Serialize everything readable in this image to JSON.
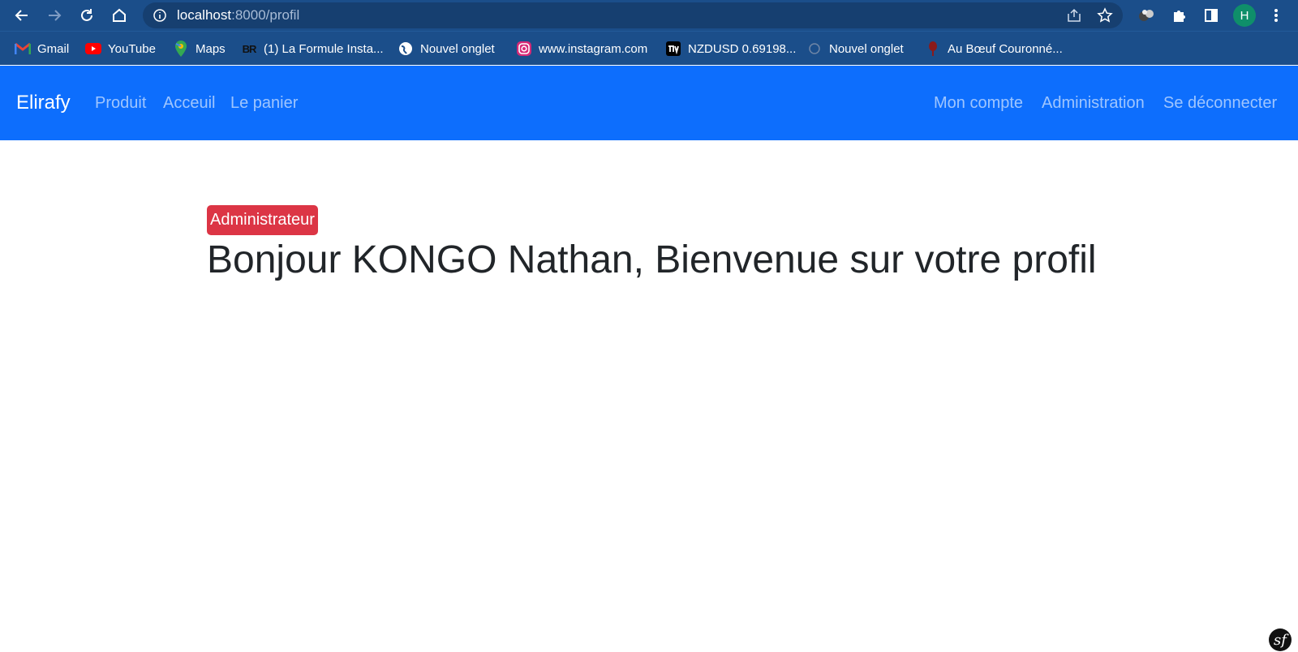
{
  "browser": {
    "url_host": "localhost",
    "url_path": ":8000/profil",
    "profile_initial": "H",
    "icons": {
      "back": "arrow-left-icon",
      "forward": "arrow-right-icon",
      "reload": "reload-icon",
      "home": "home-icon",
      "info": "info-icon",
      "share": "share-icon",
      "star": "star-icon",
      "extension": "puzzle-icon",
      "sidepanel": "side-panel-icon",
      "menu": "more-vert-icon"
    }
  },
  "bookmarks": [
    {
      "label": "Gmail",
      "icon": "gmail-icon"
    },
    {
      "label": "YouTube",
      "icon": "youtube-icon"
    },
    {
      "label": "Maps",
      "icon": "maps-icon"
    },
    {
      "label": "(1) La Formule Insta...",
      "icon": "br-icon",
      "icon_text": "BR"
    },
    {
      "label": "Nouvel onglet",
      "icon": "globe-icon"
    },
    {
      "label": "www.instagram.com",
      "icon": "instagram-icon"
    },
    {
      "label": "NZDUSD 0.69198...",
      "icon": "tradingview-icon"
    },
    {
      "label": "Nouvel onglet",
      "icon": "tab-icon"
    },
    {
      "label": "Au Bœuf Couronné...",
      "icon": "restaurant-icon"
    }
  ],
  "navbar": {
    "brand": "Elirafy",
    "left_links": [
      "Produit",
      "Acceuil",
      "Le panier"
    ],
    "right_links": [
      "Mon compte",
      "Administration",
      "Se déconnecter"
    ],
    "bg_color": "#0d6efd"
  },
  "content": {
    "badge": "Administrateur",
    "badge_color": "#dc3545",
    "heading": "Bonjour KONGO Nathan, Bienvenue sur votre profil"
  },
  "footer": {
    "symfony_logo_text": "sf"
  }
}
